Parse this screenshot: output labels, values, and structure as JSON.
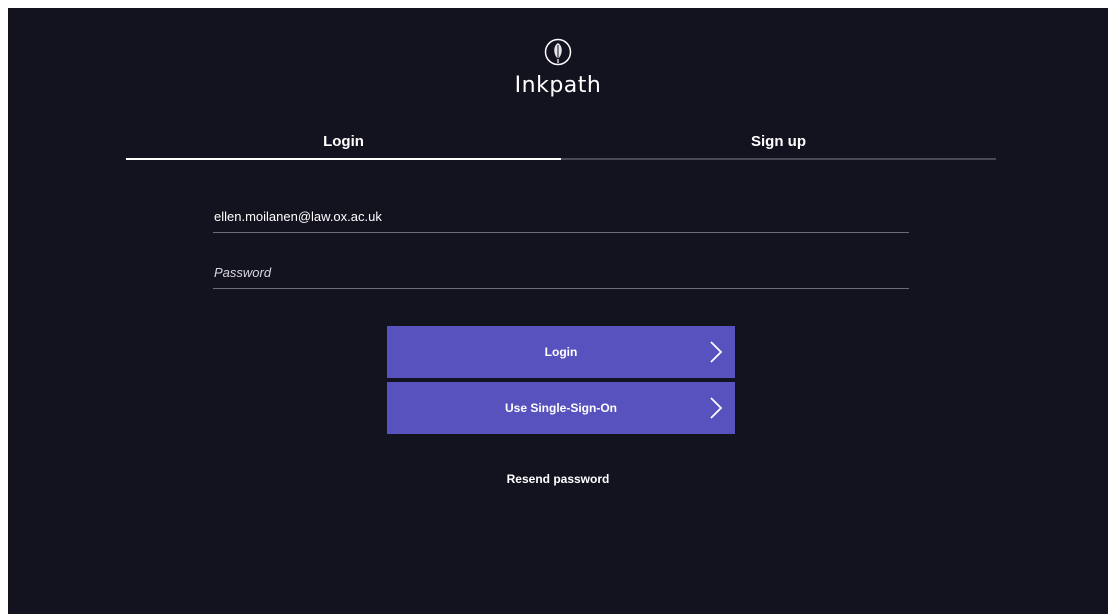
{
  "brand": {
    "name": "Inkpath",
    "logo_icon": "feather-icon"
  },
  "tabs": [
    {
      "label": "Login",
      "active": true
    },
    {
      "label": "Sign up",
      "active": false
    }
  ],
  "form": {
    "email_value": "ellen.moilanen@law.ox.ac.uk",
    "password_placeholder": "Password"
  },
  "buttons": {
    "login_label": "Login",
    "sso_label": "Use Single-Sign-On"
  },
  "links": {
    "resend_label": "Resend password"
  },
  "colors": {
    "background": "#13121f",
    "button": "#5752bd",
    "text": "#ffffff"
  }
}
